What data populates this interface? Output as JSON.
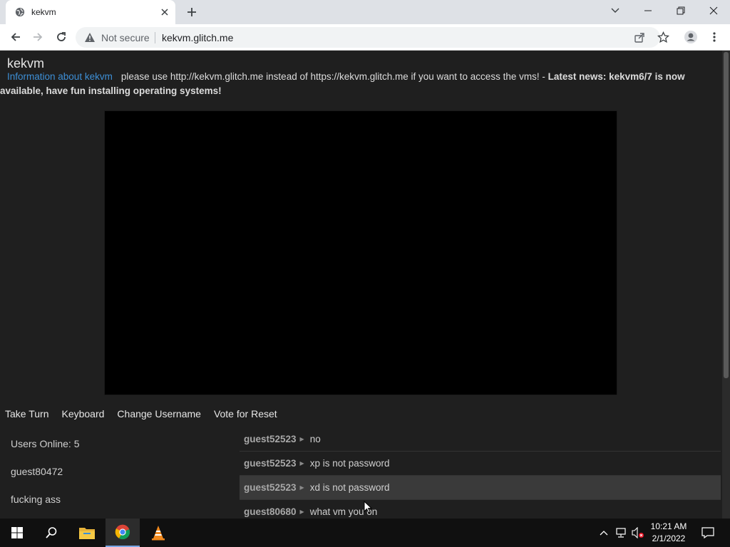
{
  "browser": {
    "tab_title": "kekvm",
    "omnibox": {
      "security_label": "Not secure",
      "url": "kekvm.glitch.me"
    }
  },
  "page": {
    "site_title": "kekvm",
    "info_link": "Information about kekvm",
    "notice": "please use http://kekvm.glitch.me instead of https://kekvm.glitch.me if you want to access the vms! - ",
    "latest_news": "Latest news: kekvm6/7 is now available, have fun installing operating systems!",
    "actions": [
      "Take Turn",
      "Keyboard",
      "Change Username",
      "Vote for Reset"
    ],
    "users_online": "Users Online: 5",
    "users": [
      "guest80472",
      "fucking ass"
    ],
    "chat": [
      {
        "user": "guest52523",
        "msg": "no"
      },
      {
        "user": "guest52523",
        "msg": "xp is not password"
      },
      {
        "user": "guest52523",
        "msg": "xd is not password"
      },
      {
        "user": "guest80680",
        "msg": "what vm you on"
      }
    ]
  },
  "taskbar": {
    "time": "10:21 AM",
    "date": "2/1/2022"
  },
  "colors": {
    "page_bg": "#1f1f1f",
    "link": "#3d8fd6",
    "taskbar_bg": "#101010"
  }
}
